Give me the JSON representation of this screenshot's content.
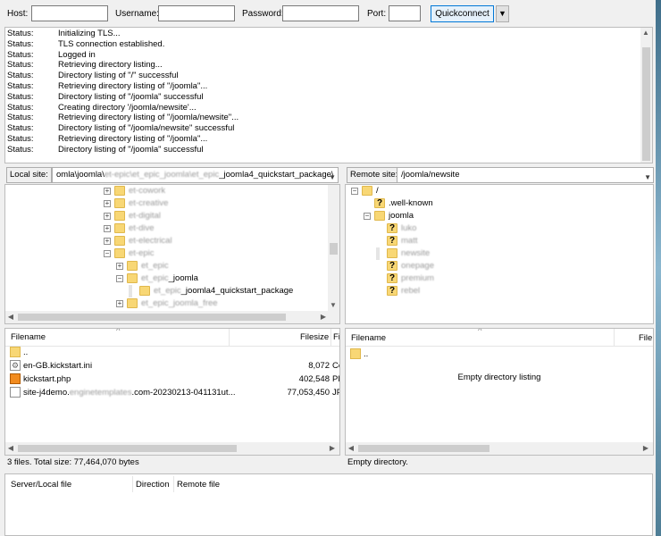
{
  "quickconnect": {
    "host_label": "Host:",
    "username_label": "Username:",
    "password_label": "Password:",
    "port_label": "Port:",
    "button_label": "Quickconnect",
    "dropdown_icon": "▼"
  },
  "log": [
    {
      "label": "Status:",
      "message": "Initializing TLS..."
    },
    {
      "label": "Status:",
      "message": "TLS connection established."
    },
    {
      "label": "Status:",
      "message": "Logged in"
    },
    {
      "label": "Status:",
      "message": "Retrieving directory listing..."
    },
    {
      "label": "Status:",
      "message": "Directory listing of \"/\" successful"
    },
    {
      "label": "Status:",
      "message": "Retrieving directory listing of \"/joomla\"..."
    },
    {
      "label": "Status:",
      "message": "Directory listing of \"/joomla\" successful"
    },
    {
      "label": "Status:",
      "message": "Creating directory '/joomla/newsite'..."
    },
    {
      "label": "Status:",
      "message": "Retrieving directory listing of \"/joomla/newsite\"..."
    },
    {
      "label": "Status:",
      "message": "Directory listing of \"/joomla/newsite\" successful"
    },
    {
      "label": "Status:",
      "message": "Retrieving directory listing of \"/joomla\"..."
    },
    {
      "label": "Status:",
      "message": "Directory listing of \"/joomla\" successful"
    }
  ],
  "local": {
    "site_label": "Local site:",
    "path_start": "omla\\joomla\\",
    "path_blurred": "et-epic\\et_epic_joomla\\et_epic",
    "path_end": "_joomla4_quickstart_package\\",
    "tree": [
      {
        "text": "et-cowork",
        "blurred": true
      },
      {
        "text": "et-creative",
        "blurred": true
      },
      {
        "text": "et-digital",
        "blurred": true
      },
      {
        "text": "et-dive",
        "blurred": true
      },
      {
        "text": "et-electrical",
        "blurred": true
      },
      {
        "text": "et-epic",
        "blurred": true
      },
      {
        "text": "et_epic",
        "blurred": true
      },
      {
        "text": "et_epic",
        "blurred": true,
        "suffix": "_joomla"
      },
      {
        "text": "et_epic",
        "blurred": true,
        "suffix": "_joomla4_quickstart_package"
      },
      {
        "text": "et_epic_joomla_free",
        "blurred": true
      }
    ],
    "columns": {
      "filename": "Filename",
      "filesize": "Filesize",
      "filetype": "Fi"
    },
    "files": [
      {
        "name": "..",
        "size": "",
        "type": "",
        "icon": "folder-icon"
      },
      {
        "name": "en-GB.kickstart.ini",
        "size": "8,072",
        "type": "Co",
        "icon": "ini-file-icon"
      },
      {
        "name": "kickstart.php",
        "size": "402,548",
        "type": "PH",
        "icon": "php-file-icon"
      },
      {
        "name_start": "site-j4demo.",
        "name_blurred": "enginetemplates",
        "name_end": ".com-20230213-041131ut...",
        "size": "77,053,450",
        "type": "JP",
        "icon": "file-icon"
      }
    ],
    "status": "3 files. Total size: 77,464,070 bytes"
  },
  "remote": {
    "site_label": "Remote site:",
    "path": "/joomla/newsite",
    "tree": [
      {
        "text": "/",
        "blurred": false
      },
      {
        "text": ".well-known",
        "blurred": false
      },
      {
        "text": "joomla",
        "blurred": false
      },
      {
        "text": "luko",
        "blurred": true
      },
      {
        "text": "matt",
        "blurred": true
      },
      {
        "text": "newsite",
        "blurred": true
      },
      {
        "text": "onepage",
        "blurred": true
      },
      {
        "text": "premium",
        "blurred": true
      },
      {
        "text": "rebel",
        "blurred": true
      }
    ],
    "columns": {
      "filename": "Filename",
      "filesize": "File"
    },
    "files": [
      {
        "name": "..",
        "icon": "folder-icon"
      }
    ],
    "empty_message": "Empty directory listing",
    "status": "Empty directory."
  },
  "queue": {
    "col_server": "Server/Local file",
    "col_direction": "Direction",
    "col_remote": "Remote file"
  },
  "colors": {
    "quickconnect_border": "#0078d7",
    "folder": "#f8d775",
    "php_icon": "#f28b1e"
  }
}
